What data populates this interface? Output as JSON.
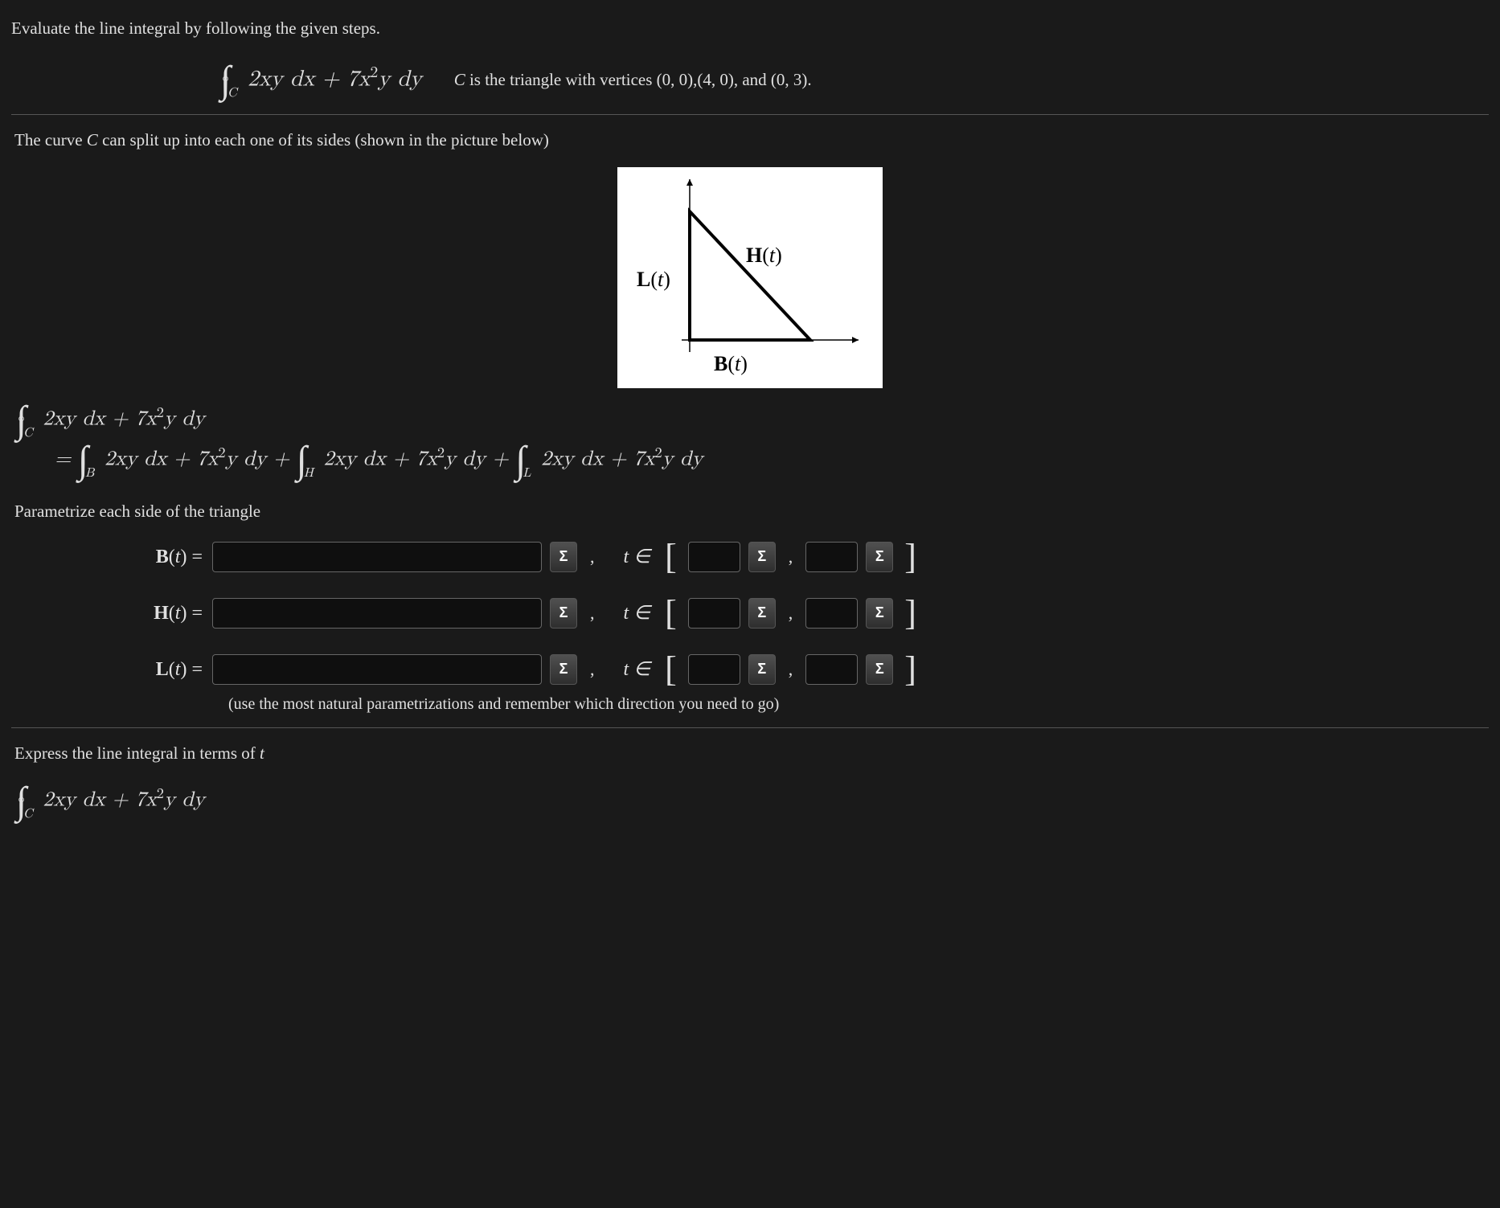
{
  "problem": {
    "prompt": "Evaluate the line integral by following the given steps.",
    "integral_tex": "2xy dx + 7x²y dy",
    "curve_description": "C is the triangle with vertices (0, 0),(4, 0), and (0, 3)."
  },
  "split_text": "The curve C can split up into each one of its sides (shown in the picture below)",
  "diagram": {
    "H_label": "H(t)",
    "L_label": "L(t)",
    "B_label": "B(t)"
  },
  "expansion": {
    "lhs": "∮_C 2xy dx + 7x²y dy",
    "rhs": "= ∫_B 2xy dx + 7x²y dy + ∫_H 2xy dx + 7x²y dy + ∫_L 2xy dx + 7x²y dy"
  },
  "parametrize_heading": "Parametrize each side of the triangle",
  "rows": [
    {
      "label": "B(t) =",
      "t_in": "t ∈"
    },
    {
      "label": "H(t) =",
      "t_in": "t ∈"
    },
    {
      "label": "L(t) =",
      "t_in": "t ∈"
    }
  ],
  "sigma": "Σ",
  "comma": ",",
  "lbracket": "[",
  "rbracket": "]",
  "hint": "(use the most natural parametrizations and remember which direction you need to go)",
  "express_heading": "Express the line integral in terms of t",
  "final_integral": "∮_C 2xy dx + 7x²y dy"
}
